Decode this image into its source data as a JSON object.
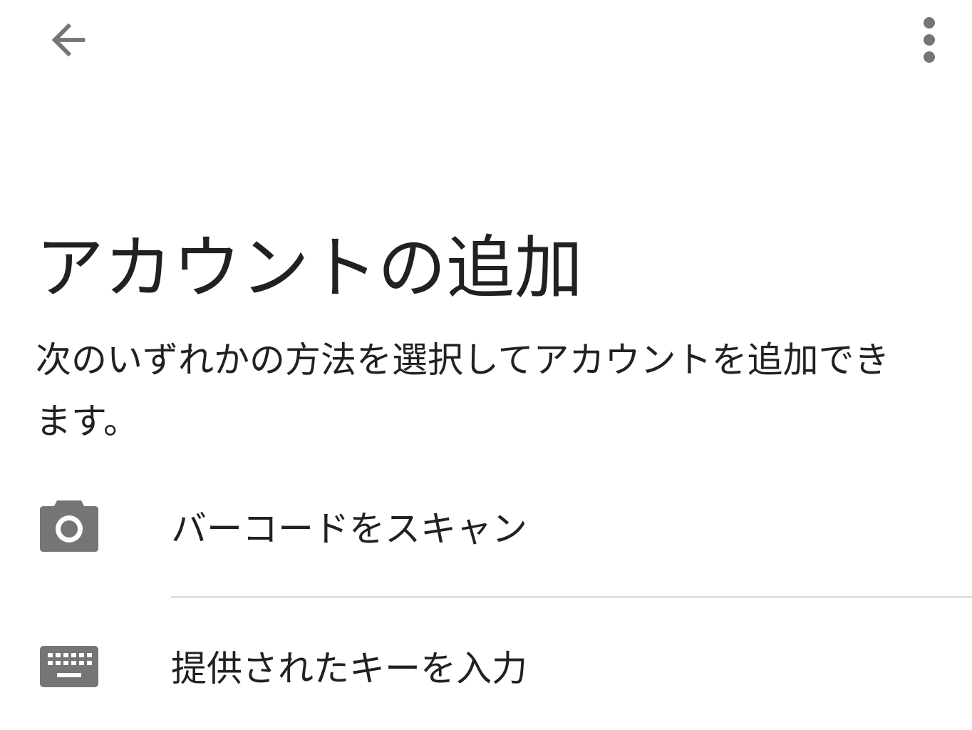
{
  "colors": {
    "icon": "#757575",
    "text": "#212121",
    "divider": "#e0e0e0",
    "background": "#ffffff"
  },
  "app_bar": {
    "back_icon": "arrow-back-icon",
    "overflow_icon": "more-vert-icon"
  },
  "title": "アカウントの追加",
  "description": "次のいずれかの方法を選択してアカウントを追加できます。",
  "options": [
    {
      "icon": "camera-icon",
      "label": "バーコードをスキャン"
    },
    {
      "icon": "keyboard-icon",
      "label": "提供されたキーを入力"
    }
  ]
}
